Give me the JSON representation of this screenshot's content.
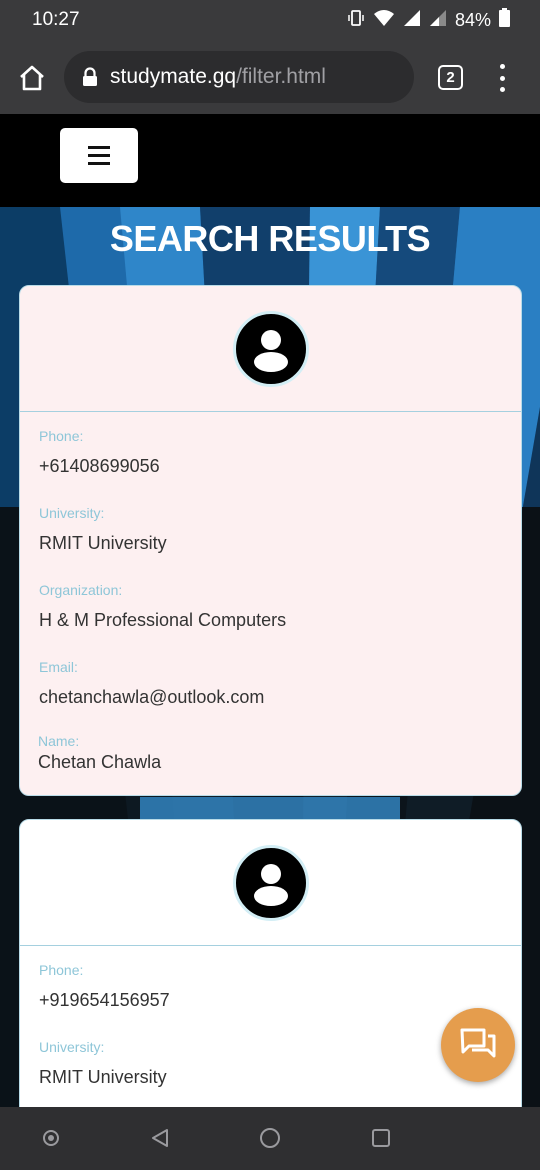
{
  "status": {
    "time": "10:27",
    "battery": "84%",
    "icons": [
      "vibrate-icon",
      "wifi-icon",
      "signal-icon",
      "signal-roaming-icon",
      "battery-icon"
    ]
  },
  "browser": {
    "url_domain": "studymate.gq",
    "url_path": "/filter.html",
    "tab_count": "2"
  },
  "page": {
    "title": "SEARCH RESULTS"
  },
  "results": [
    {
      "phone_label": "Phone:",
      "phone": "+61408699056",
      "university_label": "University:",
      "university": "RMIT University",
      "organization_label": "Organization:",
      "organization": "H & M Professional Computers",
      "email_label": "Email:",
      "email": "chetanchawla@outlook.com",
      "name_label": "Name:",
      "name": "Chetan Chawla"
    },
    {
      "phone_label": "Phone:",
      "phone": "+919654156957",
      "university_label": "University:",
      "university": "RMIT University"
    }
  ],
  "colors": {
    "accent": "#e59d4d",
    "card_pink": "#fdf0f1",
    "label_blue": "#8ec6d8",
    "bg_blue": "#1d6fb2"
  }
}
